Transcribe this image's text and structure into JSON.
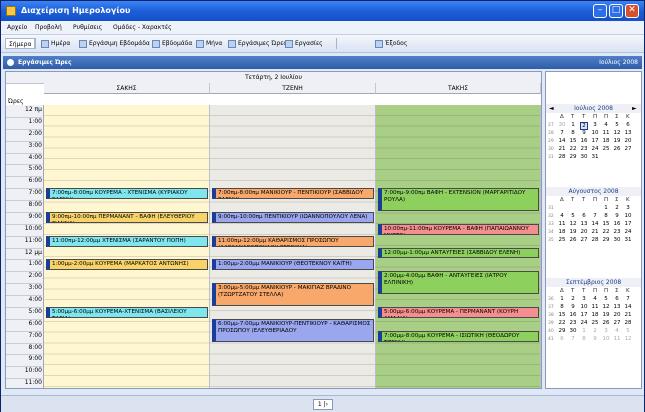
{
  "window": {
    "title": "Διαχείριση Ημερολογίου"
  },
  "menu": [
    "Αρχείο",
    "Προβολή",
    "Ρυθμίσεις",
    "Ομάδες - Χαρακτές"
  ],
  "toolbar": {
    "buttons": [
      "Σήμερα",
      "Ημέρα",
      "Εργάσιμη Εβδομάδα",
      "Εβδομάδα",
      "Μήνα",
      "Εργάσιμες Ώρες",
      "Εργασίες"
    ],
    "exit_label": "Έξοδος"
  },
  "panel": {
    "title": "Εργάσιμες Ώρες",
    "month_label": "Ιούλιος 2008"
  },
  "calendar": {
    "date_header": "Τετάρτη, 2 Ιουλίου",
    "hours_label": "Ώρες",
    "columns": [
      "ΣΑΚΗΣ",
      "ΤΖΕΝΗ",
      "ΤΑΚΗΣ"
    ],
    "hours": [
      "12 πμ",
      "1:00",
      "2:00",
      "3:00",
      "4:00",
      "5:00",
      "6:00",
      "7:00",
      "8:00",
      "9:00",
      "10:00",
      "11:00",
      "12 μμ",
      "1:00",
      "2:00",
      "3:00",
      "4:00",
      "5:00",
      "6:00",
      "7:00",
      "8:00",
      "9:00",
      "10:00",
      "11:00"
    ],
    "column_colors": [
      "#fff6d2",
      "#eceae4",
      "#a9cf86"
    ],
    "appointments": [
      {
        "col": 0,
        "start": 7,
        "end": 8,
        "color": "#7fe6ee",
        "text": "7:00πμ-8:00πμ ΚΟΥΡΕΜΑ - ΧΤΕΝΙΣΜΑ (ΚΥΡΙΑΚΟΥ ΕΛΕΝΗ)"
      },
      {
        "col": 0,
        "start": 9,
        "end": 10,
        "color": "#f7d36a",
        "text": "9:00πμ-10:00πμ ΠΕΡΜΑΝΑΝΤ - ΒΑΦΗ (ΕΛΕΥΘΕΡΙΟΥ ΓΙΑΝΝΑ)"
      },
      {
        "col": 0,
        "start": 11,
        "end": 12,
        "color": "#7fe6ee",
        "text": "11:00πμ-12:00μμ ΧΤΕΝΙΣΜΑ (ΣΑΡΑΝΤΟΥ ΠΟΠΗ)"
      },
      {
        "col": 0,
        "start": 13,
        "end": 14,
        "color": "#f7d36a",
        "text": "1:00μμ-2:00μμ ΚΟΥΡΕΜΑ (ΜΑΡΚΑΤΟΣ ΑΝΤΩΝΗΣ)"
      },
      {
        "col": 0,
        "start": 17,
        "end": 18,
        "color": "#7fe6ee",
        "text": "5:00μμ-6:00μμ ΚΟΥΡΕΜΑ-ΧΤΕΝΙΣΜΑ (ΒΑΣΙΛΕΙΟΥ ΤΑΣΙΑ)"
      },
      {
        "col": 1,
        "start": 7,
        "end": 8,
        "color": "#f7a86a",
        "text": "7:00πμ-8:00πμ ΜΑΝΙΚΙΟΥΡ - ΠΕΝΤΙΚΙΟΥΡ (ΣΑΒΒΙΔΟΥ ΕΛΕΝΗ)"
      },
      {
        "col": 1,
        "start": 9,
        "end": 10,
        "color": "#9aa6ee",
        "text": "9:00πμ-10:00πμ ΠΕΝΤΙΚΙΟΥΡ (ΙΩΑΝΝΟΠΟΥΛΟΥ ΛΕΝΑ)"
      },
      {
        "col": 1,
        "start": 11,
        "end": 12,
        "color": "#f7a86a",
        "text": "11:00πμ-12:00μμ ΚΑΘΑΡΙΣΜΟΣ ΠΡΟΣΩΠΟΥ (ΑΛΕΞΑΝΔΡΟΠΟΥΛΟΥ ΡΕΒΕΚΚΑ)"
      },
      {
        "col": 1,
        "start": 13,
        "end": 14,
        "color": "#9aa6ee",
        "text": "1:00μμ-2:00μμ ΜΑΝΙΚΙΟΥΡ (ΘΕΟΤΕΚΝΟΥ ΚΑΙΤΗ)"
      },
      {
        "col": 1,
        "start": 15,
        "end": 17,
        "color": "#f7a86a",
        "text": "3:00μμ-5:00μμ ΜΑΝΙΚΙΟΥΡ - ΜΑΚΙΓΙΑΖ ΒΡΑΔΙΝΟ (ΤΖΩΡΤΖΑΤΟΥ ΣΤΕΛΛΑ)"
      },
      {
        "col": 1,
        "start": 18,
        "end": 20,
        "color": "#9aa6ee",
        "text": "6:00μμ-7:00μμ ΜΑΝΙΚΙΟΥΡ-ΠΕΝΤΙΚΙΟΥΡ - ΚΑΘΑΡΙΣΜΟΣ ΠΡΟΣΩΠΟΥ (ΕΛΕΥΘΕΡΙΑΔΟΥ"
      },
      {
        "col": 2,
        "start": 7,
        "end": 9,
        "color": "#8ed05e",
        "text": "7:00πμ-9:00πμ ΒΑΦΗ - EXTENSION (ΜΑΡΓΑΡΙΤΙΔΟΥ ΡΟΥΛΑ)"
      },
      {
        "col": 2,
        "start": 10,
        "end": 11,
        "color": "#f58e8e",
        "text": "10:00πμ-11:00πμ ΚΟΥΡΕΜΑ - ΒΑΦΗ (ΠΑΠΑΙΩΑΝΝΟΥ ΜΥΡΤΩ)"
      },
      {
        "col": 2,
        "start": 12,
        "end": 13,
        "color": "#8ed05e",
        "text": "12:00μμ-1:00μμ ΑΝΤΑΥΓΕΙΕΣ (ΣΑΒΒΙΔΟΥ ΕΛΕΝΗ)"
      },
      {
        "col": 2,
        "start": 14,
        "end": 16,
        "color": "#8ed05e",
        "text": "2:00μμ-4:00μμ ΒΑΦΗ - ΑΝΤΑΥΓΕΙΕΣ (ΙΑΤΡΟΥ ΕΛΠΙΝΙΚΗ)"
      },
      {
        "col": 2,
        "start": 17,
        "end": 18,
        "color": "#f58e8e",
        "text": "5:00μμ-6:00μμ ΚΟΥΡΕΜΑ - ΠΕΡΜΑΝΑΝΤ (ΚΟΥΡΗ ΑΜΑΛΙΑ)"
      },
      {
        "col": 2,
        "start": 19,
        "end": 20,
        "color": "#8ed05e",
        "text": "7:00μμ-8:00μμ ΚΟΥΡΕΜΑ - ΙΣΙΩΤΙΚΗ (ΘΕΟΔΩΡΟΥ ΤΖΕΝΗ)"
      }
    ]
  },
  "minicals": [
    {
      "title": "Ιούλιος 2008",
      "dow": [
        "Δ",
        "Τ",
        "Τ",
        "Π",
        "Π",
        "Σ",
        "Κ"
      ],
      "weeks": [
        "27",
        "28",
        "29",
        "30",
        "31"
      ],
      "rows": [
        [
          "30",
          "1",
          "2",
          "3",
          "4",
          "5",
          "6"
        ],
        [
          "7",
          "8",
          "9",
          "10",
          "11",
          "12",
          "13"
        ],
        [
          "14",
          "15",
          "16",
          "17",
          "18",
          "19",
          "20"
        ],
        [
          "21",
          "22",
          "23",
          "24",
          "25",
          "26",
          "27"
        ],
        [
          "28",
          "29",
          "30",
          "31",
          "",
          "",
          ""
        ]
      ],
      "selected": "2"
    },
    {
      "title": "Αύγουστος 2008",
      "dow": [
        "Δ",
        "Τ",
        "Τ",
        "Π",
        "Π",
        "Σ",
        "Κ"
      ],
      "weeks": [
        "31",
        "32",
        "33",
        "34",
        "35"
      ],
      "rows": [
        [
          "",
          "",
          "",
          "",
          "1",
          "2",
          "3"
        ],
        [
          "4",
          "5",
          "6",
          "7",
          "8",
          "9",
          "10"
        ],
        [
          "11",
          "12",
          "13",
          "14",
          "15",
          "16",
          "17"
        ],
        [
          "18",
          "19",
          "20",
          "21",
          "22",
          "23",
          "24"
        ],
        [
          "25",
          "26",
          "27",
          "28",
          "29",
          "30",
          "31"
        ]
      ],
      "selected": ""
    },
    {
      "title": "Σεπτέμβριος 2008",
      "dow": [
        "Δ",
        "Τ",
        "Τ",
        "Π",
        "Π",
        "Σ",
        "Κ"
      ],
      "weeks": [
        "36",
        "37",
        "38",
        "39",
        "40",
        "41"
      ],
      "rows": [
        [
          "1",
          "2",
          "3",
          "4",
          "5",
          "6",
          "7"
        ],
        [
          "8",
          "9",
          "10",
          "11",
          "12",
          "13",
          "14"
        ],
        [
          "15",
          "16",
          "17",
          "18",
          "19",
          "20",
          "21"
        ],
        [
          "22",
          "23",
          "24",
          "25",
          "26",
          "27",
          "28"
        ],
        [
          "29",
          "30",
          "1",
          "2",
          "3",
          "4",
          "5"
        ],
        [
          "6",
          "7",
          "8",
          "9",
          "10",
          "11",
          "12"
        ]
      ],
      "selected": ""
    }
  ],
  "status": {
    "pager": "1 |›"
  }
}
